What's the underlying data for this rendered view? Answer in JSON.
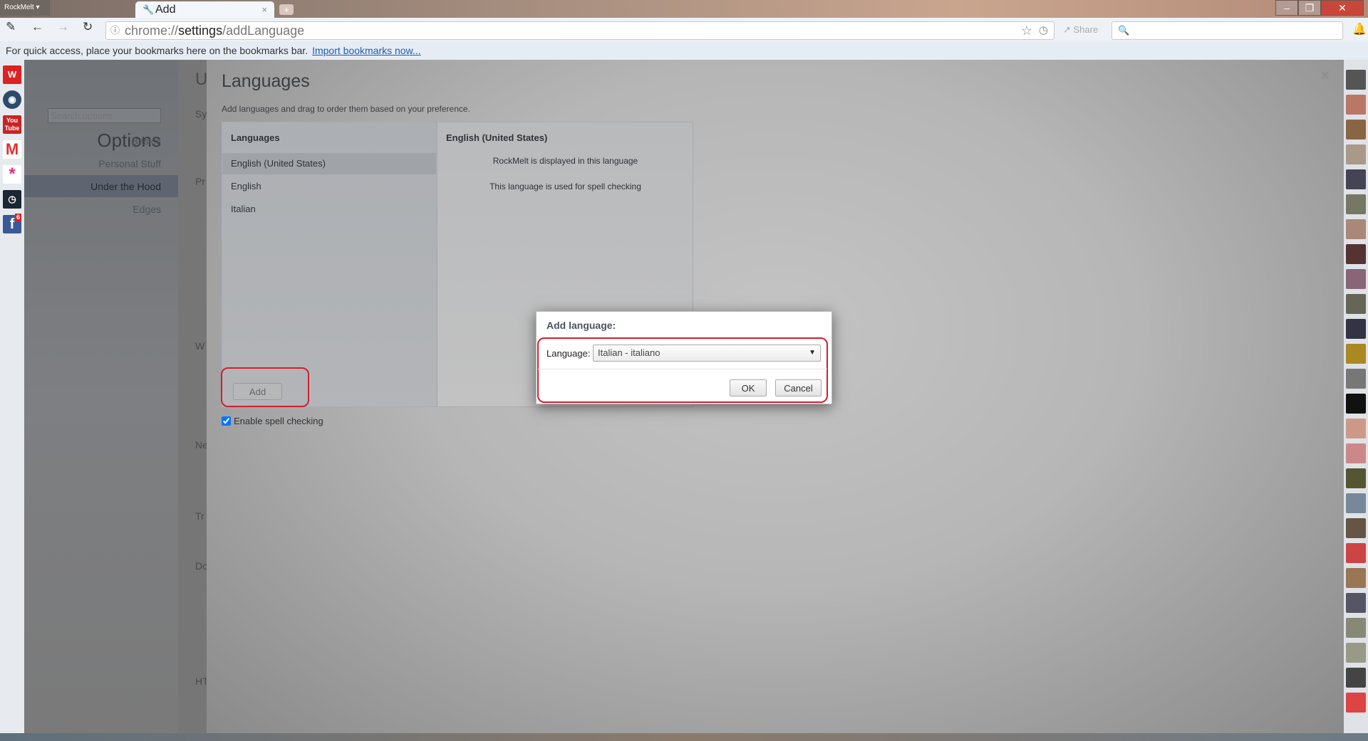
{
  "browser": {
    "app_menu": "RockMelt ▾",
    "tab_title": "Add",
    "url_host": "chrome://",
    "url_bold": "settings",
    "url_path": "/addLanguage",
    "share_label": "Share",
    "bookmarks_prompt": "For quick access, place your bookmarks here on the bookmarks bar.",
    "import_link": "Import bookmarks now...",
    "facebook_badge": "6"
  },
  "options": {
    "title": "Options",
    "search_placeholder": "Search options",
    "nav": [
      {
        "label": "Basics"
      },
      {
        "label": "Personal Stuff"
      },
      {
        "label": "Under the Hood",
        "selected": true
      },
      {
        "label": "Edges"
      }
    ],
    "background_letters": [
      "U",
      "Sy",
      "Pr",
      "W",
      "Ne",
      "Tr",
      "Do",
      "HT"
    ]
  },
  "languages": {
    "title": "Languages",
    "description": "Add languages and drag to order them based on your preference.",
    "list_header": "Languages",
    "items": [
      {
        "label": "English (United States)",
        "selected": true
      },
      {
        "label": "English"
      },
      {
        "label": "Italian"
      }
    ],
    "detail_header": "English (United States)",
    "detail_lines": [
      "RockMelt is displayed in this language",
      "This language is used for spell checking"
    ],
    "add_button": "Add",
    "spell_check_label": "Enable spell checking",
    "spell_check_enabled": true
  },
  "dialog": {
    "title": "Add language:",
    "language_label": "Language:",
    "selected_language": "Italian - italiano",
    "ok": "OK",
    "cancel": "Cancel"
  },
  "colors": {
    "highlight_ring": "#d0202e",
    "link": "#1a5fb4"
  }
}
